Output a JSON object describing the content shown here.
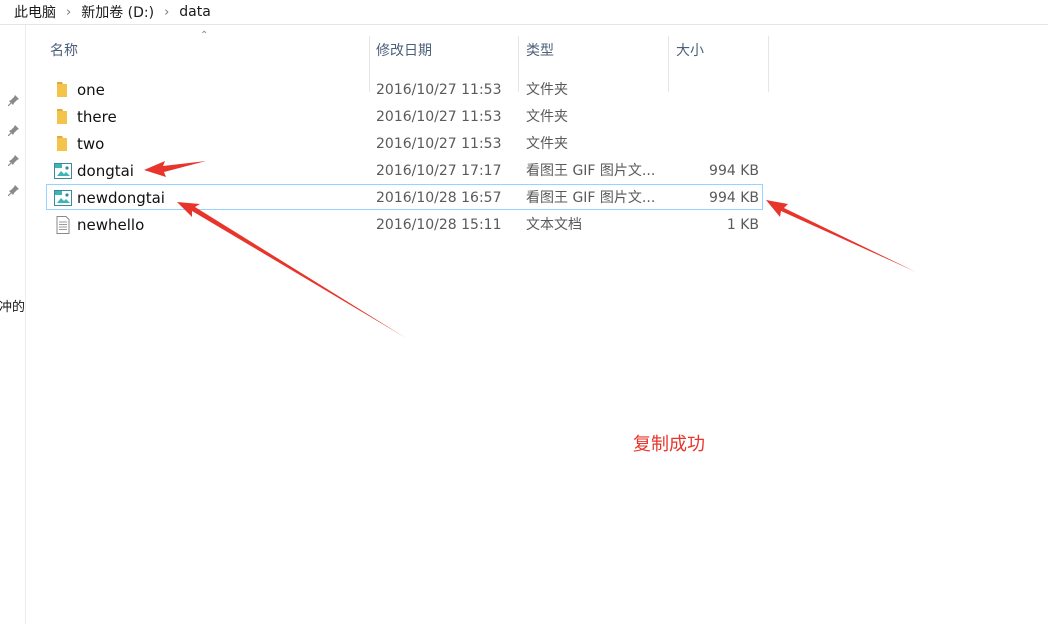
{
  "breadcrumb": {
    "items": [
      "此电脑",
      "新加卷 (D:)",
      "data"
    ]
  },
  "navigation": {
    "partial_text": "冲的"
  },
  "columns": {
    "name": "名称",
    "date": "修改日期",
    "type": "类型",
    "size": "大小"
  },
  "files": [
    {
      "name": "one",
      "date": "2016/10/27 11:53",
      "type": "文件夹",
      "size": "",
      "icon": "folder-icon",
      "selected": false
    },
    {
      "name": "there",
      "date": "2016/10/27 11:53",
      "type": "文件夹",
      "size": "",
      "icon": "folder-icon",
      "selected": false
    },
    {
      "name": "two",
      "date": "2016/10/27 11:53",
      "type": "文件夹",
      "size": "",
      "icon": "folder-icon",
      "selected": false
    },
    {
      "name": "dongtai",
      "date": "2016/10/27 17:17",
      "type": "看图王 GIF 图片文...",
      "size": "994 KB",
      "icon": "gif-file-icon",
      "selected": false
    },
    {
      "name": "newdongtai",
      "date": "2016/10/28 16:57",
      "type": "看图王 GIF 图片文...",
      "size": "994 KB",
      "icon": "gif-file-icon",
      "selected": true
    },
    {
      "name": "newhello",
      "date": "2016/10/28 15:11",
      "type": "文本文档",
      "size": "1 KB",
      "icon": "text-file-icon",
      "selected": false
    }
  ],
  "annotation": {
    "text": "复制成功"
  },
  "colors": {
    "arrow": "#e8352b",
    "folder": "#f4c44a",
    "selection_border": "#99d1ff",
    "annotation_text": "#e8352b"
  }
}
